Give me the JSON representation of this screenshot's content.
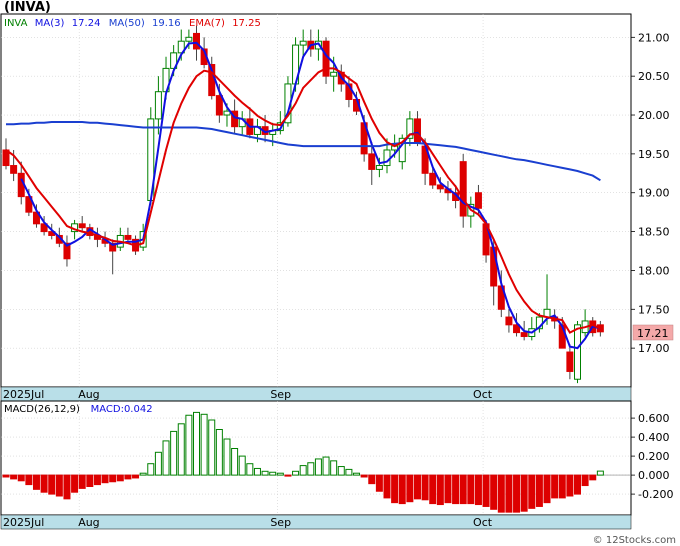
{
  "title": "(INVA)",
  "watermark": "© 12Stocks.com",
  "colors": {
    "up": "#008000",
    "down": "#dd0000",
    "ma3": "#1010e0",
    "ma50": "#1a3fd0",
    "ema7": "#e00000",
    "axis_band": "#b9dfe8",
    "price_box": "#f4a9a9"
  },
  "price_legend": [
    {
      "text": "INVA",
      "color": "#008000"
    },
    {
      "text": "MA(3)",
      "color": "#1010e0"
    },
    {
      "text": "17.24",
      "color": "#1010e0"
    },
    {
      "text": "MA(50)",
      "color": "#1a3fd0"
    },
    {
      "text": "19.16",
      "color": "#1a3fd0"
    },
    {
      "text": "EMA(7)",
      "color": "#e00000"
    },
    {
      "text": "17.25",
      "color": "#e00000"
    }
  ],
  "macd_legend": [
    {
      "text": "MACD(26,12,9)",
      "color": "#000000"
    },
    {
      "text": "MACD:0.042",
      "color": "#1010e0"
    }
  ],
  "last_price_label": "17.21",
  "x_labels": [
    "2025Jul",
    "Aug",
    "Sep",
    "Oct"
  ],
  "chart_data": [
    {
      "type": "candlestick",
      "title": "(INVA)",
      "ylim": [
        16.5,
        21.3
      ],
      "yticks": [
        "21.00",
        "20.50",
        "20.00",
        "19.50",
        "19.00",
        "18.50",
        "18.00",
        "17.50",
        "17.00"
      ],
      "xticks": [
        "2025Jul",
        "Aug",
        "Sep",
        "Oct"
      ],
      "candles": [
        [
          19.55,
          19.7,
          19.3,
          19.35
        ],
        [
          19.35,
          19.55,
          19.15,
          19.25
        ],
        [
          19.25,
          19.4,
          18.85,
          18.95
        ],
        [
          18.95,
          19.05,
          18.7,
          18.75
        ],
        [
          18.75,
          18.85,
          18.55,
          18.6
        ],
        [
          18.6,
          18.7,
          18.45,
          18.5
        ],
        [
          18.5,
          18.6,
          18.4,
          18.45
        ],
        [
          18.45,
          18.55,
          18.3,
          18.35
        ],
        [
          18.35,
          18.45,
          18.05,
          18.15
        ],
        [
          18.5,
          18.65,
          18.4,
          18.6
        ],
        [
          18.6,
          18.7,
          18.5,
          18.55
        ],
        [
          18.55,
          18.6,
          18.4,
          18.45
        ],
        [
          18.45,
          18.55,
          18.3,
          18.4
        ],
        [
          18.4,
          18.5,
          18.3,
          18.35
        ],
        [
          18.35,
          18.4,
          17.95,
          18.25
        ],
        [
          18.3,
          18.55,
          18.25,
          18.45
        ],
        [
          18.45,
          18.55,
          18.35,
          18.4
        ],
        [
          18.4,
          18.45,
          18.2,
          18.25
        ],
        [
          18.3,
          18.6,
          18.25,
          18.5
        ],
        [
          18.9,
          20.1,
          18.85,
          19.95
        ],
        [
          19.95,
          20.5,
          19.75,
          20.3
        ],
        [
          20.3,
          20.75,
          20.2,
          20.6
        ],
        [
          20.6,
          20.9,
          20.5,
          20.8
        ],
        [
          20.8,
          21.1,
          20.7,
          20.95
        ],
        [
          20.95,
          21.1,
          20.85,
          21.0
        ],
        [
          21.05,
          21.15,
          20.7,
          20.85
        ],
        [
          20.85,
          21.0,
          20.6,
          20.65
        ],
        [
          20.65,
          20.75,
          20.2,
          20.25
        ],
        [
          20.25,
          20.4,
          19.9,
          20.0
        ],
        [
          20.0,
          20.15,
          19.85,
          20.05
        ],
        [
          20.05,
          20.2,
          19.75,
          19.85
        ],
        [
          19.85,
          20.05,
          19.75,
          19.95
        ],
        [
          19.95,
          20.1,
          19.7,
          19.75
        ],
        [
          19.75,
          19.95,
          19.65,
          19.85
        ],
        [
          19.85,
          20.0,
          19.65,
          19.75
        ],
        [
          19.75,
          19.9,
          19.6,
          19.8
        ],
        [
          19.8,
          20.05,
          19.75,
          19.9
        ],
        [
          19.9,
          20.5,
          19.85,
          20.4
        ],
        [
          20.4,
          21.0,
          20.3,
          20.9
        ],
        [
          20.9,
          21.1,
          20.75,
          20.95
        ],
        [
          20.95,
          21.1,
          20.75,
          20.85
        ],
        [
          20.85,
          21.1,
          20.7,
          20.95
        ],
        [
          20.95,
          21.0,
          20.4,
          20.5
        ],
        [
          20.5,
          20.75,
          20.3,
          20.55
        ],
        [
          20.55,
          20.65,
          20.3,
          20.4
        ],
        [
          20.4,
          20.5,
          20.1,
          20.2
        ],
        [
          20.2,
          20.3,
          20.0,
          20.05
        ],
        [
          19.9,
          20.0,
          19.4,
          19.5
        ],
        [
          19.5,
          19.65,
          19.1,
          19.3
        ],
        [
          19.3,
          19.45,
          19.2,
          19.35
        ],
        [
          19.35,
          19.7,
          19.25,
          19.55
        ],
        [
          19.55,
          19.75,
          19.45,
          19.6
        ],
        [
          19.4,
          19.75,
          19.3,
          19.7
        ],
        [
          19.7,
          20.05,
          19.6,
          19.95
        ],
        [
          19.95,
          20.05,
          19.6,
          19.65
        ],
        [
          19.6,
          19.7,
          19.1,
          19.25
        ],
        [
          19.25,
          19.35,
          19.05,
          19.1
        ],
        [
          19.1,
          19.2,
          19.0,
          19.05
        ],
        [
          19.05,
          19.15,
          18.9,
          19.0
        ],
        [
          19.0,
          19.1,
          18.8,
          18.9
        ],
        [
          19.4,
          19.5,
          18.55,
          18.7
        ],
        [
          18.7,
          18.95,
          18.55,
          18.85
        ],
        [
          19.0,
          19.1,
          18.7,
          18.8
        ],
        [
          18.6,
          18.65,
          18.1,
          18.2
        ],
        [
          18.3,
          18.4,
          17.55,
          17.8
        ],
        [
          17.8,
          18.0,
          17.4,
          17.5
        ],
        [
          17.4,
          17.5,
          17.2,
          17.3
        ],
        [
          17.3,
          17.45,
          17.15,
          17.2
        ],
        [
          17.2,
          17.35,
          17.1,
          17.15
        ],
        [
          17.15,
          17.4,
          17.1,
          17.25
        ],
        [
          17.25,
          17.45,
          17.2,
          17.4
        ],
        [
          17.4,
          17.95,
          17.3,
          17.5
        ],
        [
          17.4,
          17.5,
          17.25,
          17.35
        ],
        [
          17.3,
          17.4,
          17.1,
          17.0
        ],
        [
          16.95,
          17.05,
          16.6,
          16.7
        ],
        [
          16.6,
          17.35,
          16.55,
          17.3
        ],
        [
          17.2,
          17.5,
          17.15,
          17.35
        ],
        [
          17.35,
          17.4,
          17.15,
          17.2
        ],
        [
          17.3,
          17.35,
          17.15,
          17.21
        ]
      ],
      "series": [
        {
          "name": "MA(3)",
          "values": [
            null,
            null,
            19.18,
            18.98,
            18.77,
            18.62,
            18.52,
            18.43,
            18.32,
            18.37,
            18.43,
            18.53,
            18.47,
            18.4,
            18.33,
            18.35,
            18.37,
            18.37,
            18.4,
            18.9,
            19.58,
            20.28,
            20.57,
            20.78,
            20.92,
            20.93,
            20.83,
            20.58,
            20.3,
            20.1,
            19.97,
            19.95,
            19.85,
            19.85,
            19.78,
            19.8,
            19.82,
            20.03,
            20.4,
            20.75,
            20.9,
            20.92,
            20.77,
            20.67,
            20.48,
            20.38,
            20.22,
            19.92,
            19.62,
            19.38,
            19.4,
            19.5,
            19.62,
            19.75,
            19.77,
            19.62,
            19.33,
            19.13,
            19.05,
            18.98,
            18.87,
            18.82,
            18.78,
            18.62,
            18.27,
            17.83,
            17.53,
            17.33,
            17.22,
            17.2,
            17.27,
            17.38,
            17.42,
            17.28,
            17.02,
            17.0,
            17.12,
            17.28,
            17.25
          ]
        },
        {
          "name": "MA(50)",
          "values": [
            19.88,
            19.88,
            19.89,
            19.89,
            19.9,
            19.9,
            19.91,
            19.91,
            19.91,
            19.91,
            19.91,
            19.9,
            19.9,
            19.89,
            19.88,
            19.87,
            19.86,
            19.85,
            19.84,
            19.84,
            19.84,
            19.84,
            19.84,
            19.84,
            19.84,
            19.84,
            19.83,
            19.82,
            19.8,
            19.78,
            19.76,
            19.74,
            19.72,
            19.7,
            19.68,
            19.66,
            19.64,
            19.62,
            19.61,
            19.6,
            19.6,
            19.6,
            19.6,
            19.6,
            19.6,
            19.6,
            19.6,
            19.6,
            19.6,
            19.6,
            19.62,
            19.63,
            19.64,
            19.64,
            19.64,
            19.63,
            19.62,
            19.61,
            19.6,
            19.59,
            19.57,
            19.55,
            19.53,
            19.51,
            19.49,
            19.47,
            19.45,
            19.43,
            19.42,
            19.4,
            19.38,
            19.36,
            19.34,
            19.32,
            19.3,
            19.28,
            19.25,
            19.22,
            19.16
          ]
        },
        {
          "name": "EMA(7)",
          "values": [
            19.55,
            19.48,
            19.36,
            19.21,
            19.06,
            18.94,
            18.82,
            18.7,
            18.57,
            18.53,
            18.5,
            18.48,
            18.45,
            18.42,
            18.38,
            18.37,
            18.35,
            18.32,
            18.35,
            18.75,
            19.15,
            19.55,
            19.9,
            20.15,
            20.35,
            20.5,
            20.57,
            20.55,
            20.45,
            20.35,
            20.25,
            20.16,
            20.08,
            19.99,
            19.93,
            19.88,
            19.87,
            19.99,
            20.15,
            20.35,
            20.45,
            20.55,
            20.6,
            20.6,
            20.55,
            20.47,
            20.4,
            20.17,
            19.95,
            19.77,
            19.65,
            19.6,
            19.65,
            19.75,
            19.75,
            19.65,
            19.5,
            19.35,
            19.2,
            19.08,
            18.92,
            18.78,
            18.72,
            18.6,
            18.4,
            18.18,
            17.95,
            17.75,
            17.6,
            17.48,
            17.42,
            17.4,
            17.38,
            17.36,
            17.2,
            17.25,
            17.27,
            17.3,
            17.25
          ]
        }
      ]
    },
    {
      "type": "bar",
      "title": "MACD(26,12,9)",
      "ylim": [
        -0.42,
        0.78
      ],
      "yticks": [
        "0.600",
        "0.400",
        "0.200",
        "0.000",
        "-0.200"
      ],
      "values": [
        -0.02,
        -0.04,
        -0.06,
        -0.1,
        -0.15,
        -0.18,
        -0.2,
        -0.22,
        -0.25,
        -0.18,
        -0.14,
        -0.12,
        -0.1,
        -0.08,
        -0.07,
        -0.06,
        -0.04,
        -0.03,
        0.02,
        0.12,
        0.24,
        0.36,
        0.46,
        0.54,
        0.63,
        0.66,
        0.64,
        0.58,
        0.48,
        0.38,
        0.28,
        0.2,
        0.12,
        0.07,
        0.04,
        0.03,
        0.02,
        -0.01,
        0.04,
        0.1,
        0.13,
        0.17,
        0.19,
        0.15,
        0.09,
        0.06,
        0.02,
        -0.02,
        -0.09,
        -0.17,
        -0.24,
        -0.29,
        -0.3,
        -0.28,
        -0.25,
        -0.26,
        -0.3,
        -0.31,
        -0.29,
        -0.3,
        -0.3,
        -0.3,
        -0.31,
        -0.33,
        -0.36,
        -0.39,
        -0.39,
        -0.39,
        -0.38,
        -0.35,
        -0.33,
        -0.29,
        -0.24,
        -0.24,
        -0.22,
        -0.2,
        -0.11,
        -0.05,
        0.042
      ]
    }
  ]
}
